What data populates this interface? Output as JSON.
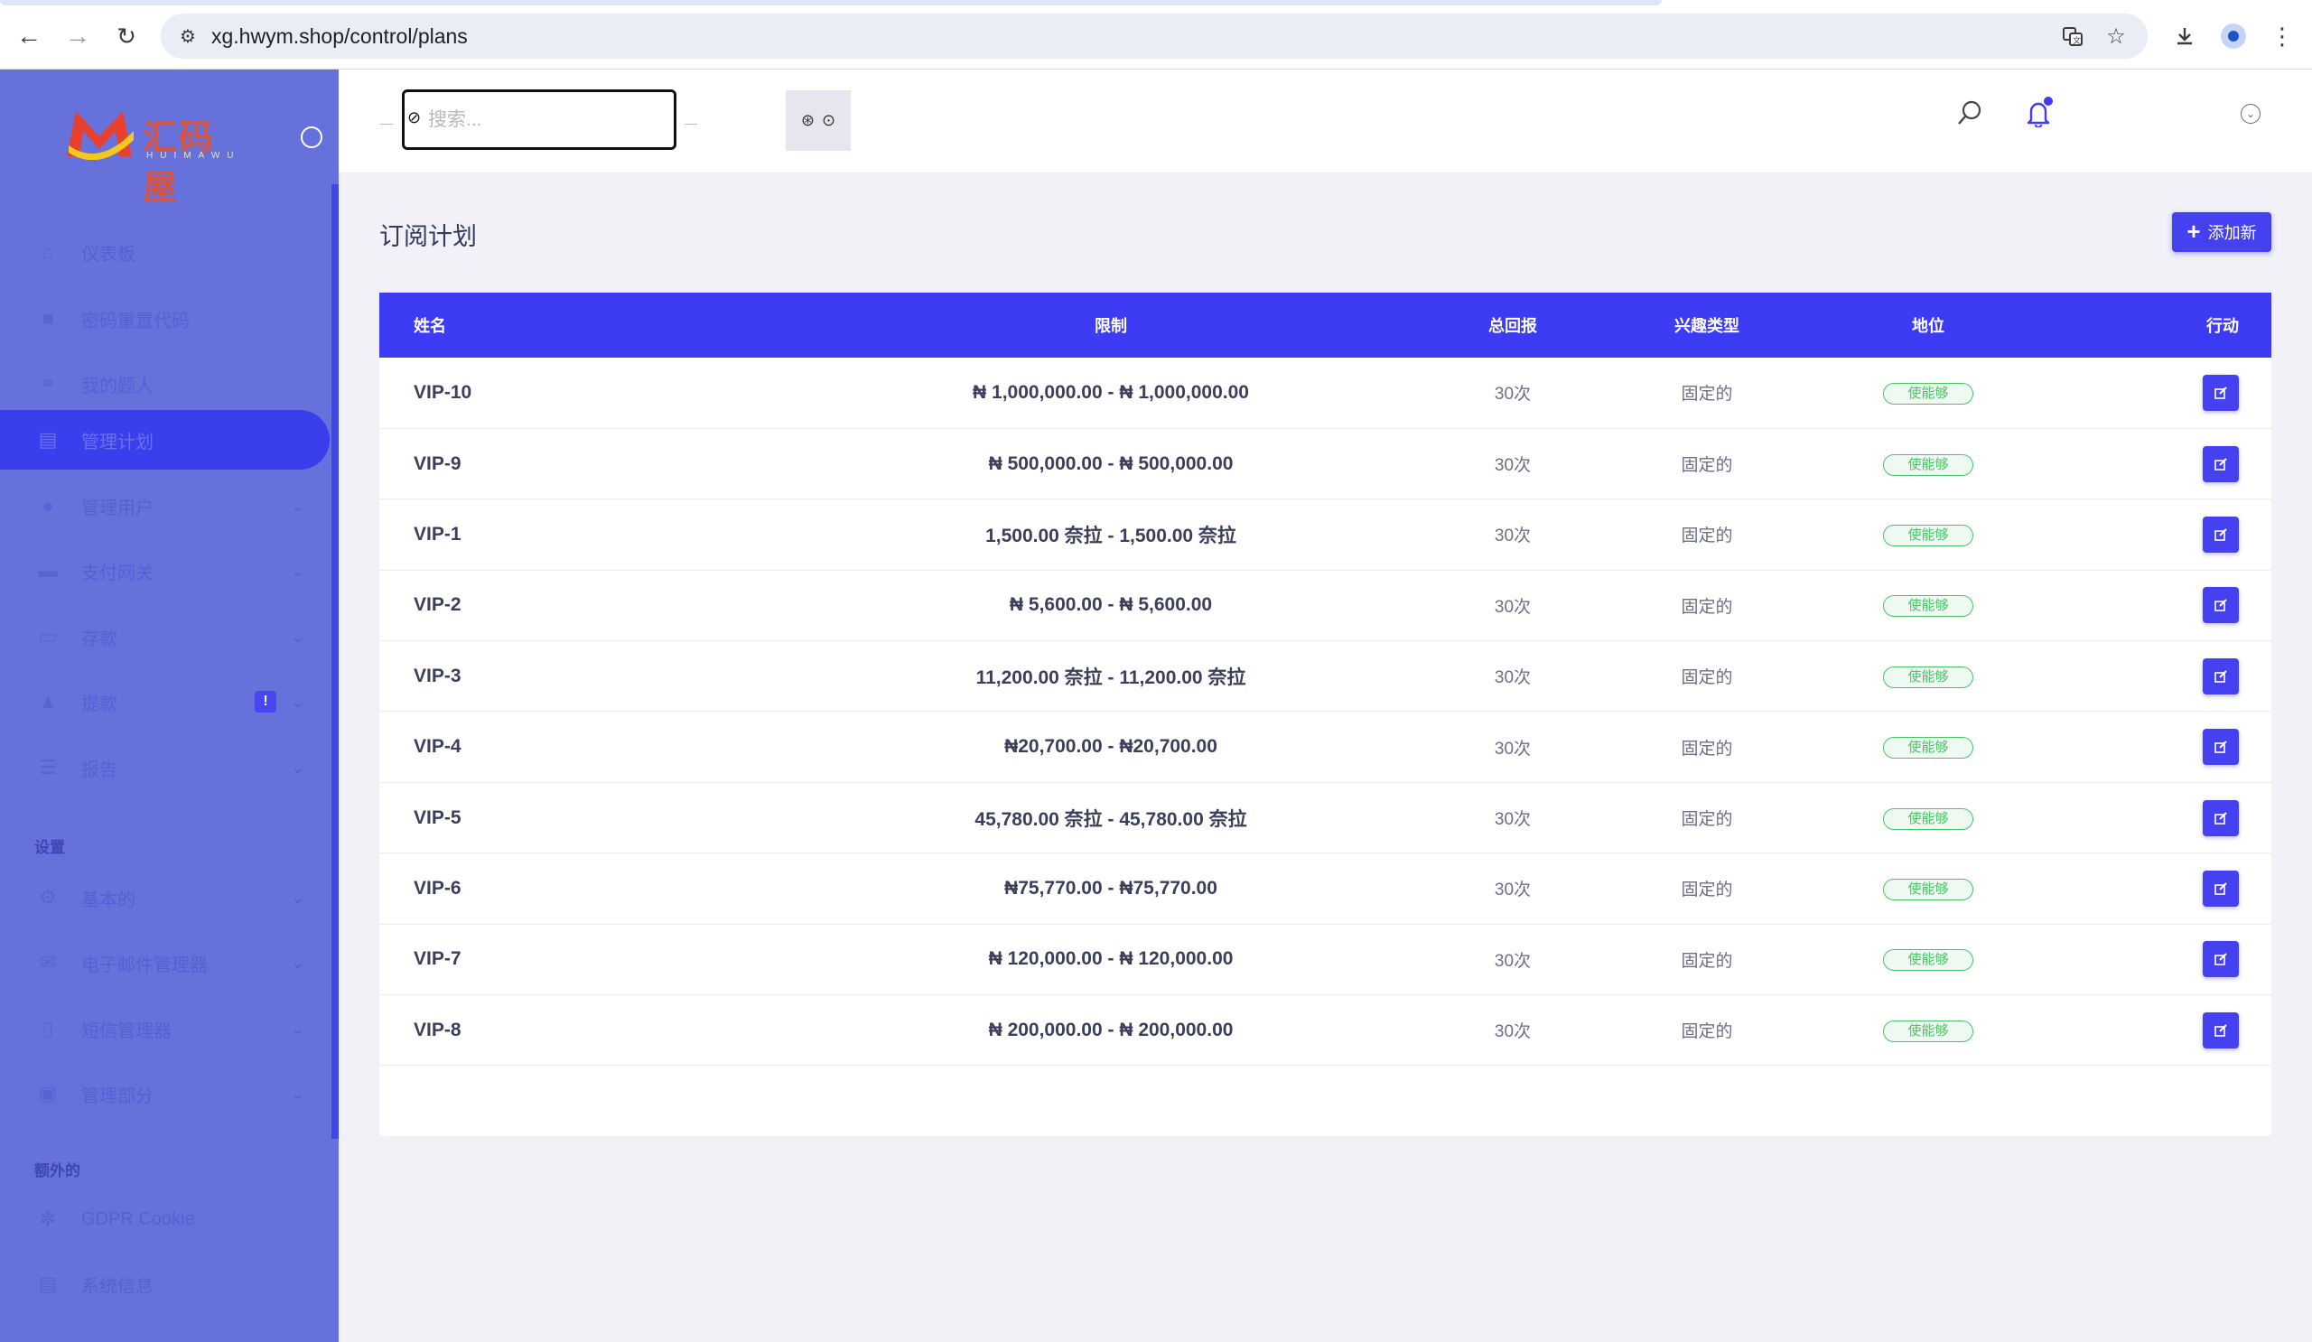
{
  "browser": {
    "url": "xg.hwym.shop/control/plans"
  },
  "sidebar": {
    "logo_text": "汇码屋",
    "logo_sub": "HUIMAWU",
    "items": [
      {
        "label": "仪表板",
        "icon": "home-icon",
        "chevron": false
      },
      {
        "label": "密码重置代码",
        "icon": "lock-icon",
        "chevron": false
      },
      {
        "label": "我的题人",
        "icon": "link-icon",
        "chevron": false
      },
      {
        "label": "管理计划",
        "icon": "plan-icon",
        "chevron": false,
        "active": true
      },
      {
        "label": "管理用户",
        "icon": "users-icon",
        "chevron": true
      },
      {
        "label": "支付网关",
        "icon": "credit-card-icon",
        "chevron": true
      },
      {
        "label": "存款",
        "icon": "wallet-icon",
        "chevron": true
      },
      {
        "label": "提款",
        "icon": "bank-icon",
        "chevron": true,
        "badge": "!"
      },
      {
        "label": "报告",
        "icon": "list-icon",
        "chevron": true
      }
    ],
    "settings_header": "设置",
    "settings_items": [
      {
        "label": "基本的",
        "icon": "gear-icon",
        "chevron": true
      },
      {
        "label": "电子邮件管理器",
        "icon": "email-icon",
        "chevron": true
      },
      {
        "label": "短信管理器",
        "icon": "mobile-icon",
        "chevron": true
      },
      {
        "label": "管理部分",
        "icon": "layers-icon",
        "chevron": true
      }
    ],
    "extra_header": "额外的",
    "extra_items": [
      {
        "label": "GDPR Cookie",
        "icon": "cookie-icon",
        "chevron": false
      },
      {
        "label": "系统信息",
        "icon": "server-icon",
        "chevron": false
      }
    ]
  },
  "topbar": {
    "search_placeholder": "搜索..."
  },
  "page": {
    "title": "订阅计划",
    "add_button": "添加新"
  },
  "table": {
    "headers": [
      "姓名",
      "限制",
      "总回报",
      "兴趣类型",
      "地位",
      "行动"
    ],
    "rows": [
      {
        "name": "VIP-10",
        "limit": "₦ 1,000,000.00 - ₦ 1,000,000.00",
        "return": "30次",
        "type": "固定的",
        "status": "使能够"
      },
      {
        "name": "VIP-9",
        "limit": "₦ 500,000.00 - ₦ 500,000.00",
        "return": "30次",
        "type": "固定的",
        "status": "使能够"
      },
      {
        "name": "VIP-1",
        "limit": "1,500.00 奈拉 - 1,500.00 奈拉",
        "return": "30次",
        "type": "固定的",
        "status": "使能够"
      },
      {
        "name": "VIP-2",
        "limit": "₦ 5,600.00 - ₦ 5,600.00",
        "return": "30次",
        "type": "固定的",
        "status": "使能够"
      },
      {
        "name": "VIP-3",
        "limit": "11,200.00 奈拉 - 11,200.00 奈拉",
        "return": "30次",
        "type": "固定的",
        "status": "使能够"
      },
      {
        "name": "VIP-4",
        "limit": "₦20,700.00 - ₦20,700.00",
        "return": "30次",
        "type": "固定的",
        "status": "使能够"
      },
      {
        "name": "VIP-5",
        "limit": "45,780.00 奈拉 - 45,780.00 奈拉",
        "return": "30次",
        "type": "固定的",
        "status": "使能够"
      },
      {
        "name": "VIP-6",
        "limit": "₦75,770.00 - ₦75,770.00",
        "return": "30次",
        "type": "固定的",
        "status": "使能够"
      },
      {
        "name": "VIP-7",
        "limit": "₦ 120,000.00 - ₦ 120,000.00",
        "return": "30次",
        "type": "固定的",
        "status": "使能够"
      },
      {
        "name": "VIP-8",
        "limit": "₦ 200,000.00 - ₦ 200,000.00",
        "return": "30次",
        "type": "固定的",
        "status": "使能够"
      }
    ]
  },
  "colors": {
    "sidebar_bg": "#6771dc",
    "primary": "#3e3bf4",
    "success": "#47c363"
  }
}
